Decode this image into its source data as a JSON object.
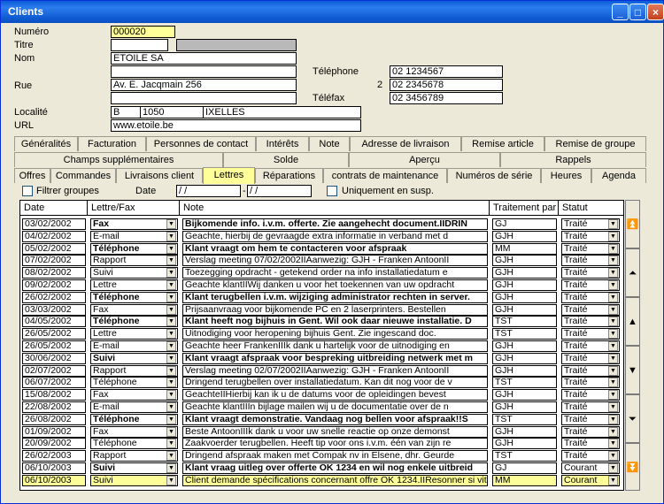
{
  "window": {
    "title": "Clients"
  },
  "form": {
    "numero_label": "Numéro",
    "numero": "000020",
    "titre_label": "Titre",
    "titre": "",
    "nom_label": "Nom",
    "nom": "ETOILE SA",
    "rue_label": "Rue",
    "rue1": "",
    "rue2": "Av. E. Jacqmain 256",
    "rue3": "",
    "telephone_label": "Téléphone",
    "telephone1": "02 1234567",
    "tel2_index": "2",
    "telephone2": "02 2345678",
    "telefax_label": "Téléfax",
    "telefax": "02 3456789",
    "localite_label": "Localité",
    "pays": "B",
    "cp": "1050",
    "ville": "IXELLES",
    "url_label": "URL",
    "url": "www.etoile.be"
  },
  "tabs_row1": [
    "Généralités",
    "Facturation",
    "Personnes de contact",
    "Intérêts",
    "Note",
    "Adresse de livraison",
    "Remise article",
    "Remise de groupe"
  ],
  "tabs_row2": [
    "Champs supplémentaires",
    "Solde",
    "Aperçu",
    "Rappels"
  ],
  "tabs_row3": [
    "Offres",
    "Commandes",
    "Livraisons client",
    "Lettres",
    "Réparations",
    "contrats de maintenance",
    "Numéros de série",
    "Heures",
    "Agenda"
  ],
  "filters": {
    "filtrer_groupes": "Filtrer groupes",
    "date_label": "Date",
    "date_from": " /  /",
    "date_sep": "-",
    "date_to": " /  /",
    "uniquement": "Uniquement en susp."
  },
  "columns": [
    "Date",
    "Lettre/Fax",
    "Note",
    "Traitement par",
    "Statut"
  ],
  "rows": [
    [
      "03/02/2002",
      "Fax",
      "Bijkomende info. i.v.m. offerte. Zie aangehecht document.IIDRIN",
      "GJ",
      "Traité",
      1
    ],
    [
      "04/02/2002",
      "E-mail",
      "Geachte, hierbij de gevraagde extra informatie in verband met d",
      "GJH",
      "Traité",
      0
    ],
    [
      "05/02/2002",
      "Téléphone",
      "Klant vraagt om hem te contacteren voor afspraak",
      "MM",
      "Traité",
      1
    ],
    [
      "07/02/2002",
      "Rapport",
      "Verslag meeting 07/02/2002IIAanwezig: GJH - Franken AntoonII",
      "GJH",
      "Traité",
      0
    ],
    [
      "08/02/2002",
      "Suivi",
      "Toezegging opdracht - getekend order na info installatiedatum e",
      "GJH",
      "Traité",
      0
    ],
    [
      "09/02/2002",
      "Lettre",
      "Geachte klantIIWij danken u voor het toekennen van uw opdracht",
      "GJH",
      "Traité",
      0
    ],
    [
      "26/02/2002",
      "Téléphone",
      "Klant terugbellen i.v.m. wijziging administrator rechten in server.",
      "GJH",
      "Traité",
      1
    ],
    [
      "03/03/2002",
      "Fax",
      "Prijsaanvraag voor bijkomende PC en 2 laserprinters. Bestellen",
      "GJH",
      "Traité",
      0
    ],
    [
      "04/05/2002",
      "Téléphone",
      "Klant heeft nog bijhuis in Gent. Wil ook daar nieuwe installatie. D",
      "TST",
      "Traité",
      1
    ],
    [
      "26/05/2002",
      "Lettre",
      "Uitnodiging voor heropening bijhuis Gent. Zie ingescand doc.",
      "TST",
      "Traité",
      0
    ],
    [
      "26/05/2002",
      "E-mail",
      "Geachte heer FrankenIIIk dank u hartelijk voor de uitnodiging en",
      "GJH",
      "Traité",
      0
    ],
    [
      "30/06/2002",
      "Suivi",
      "Klant vraagt afspraak voor bespreking uitbreiding netwerk met m",
      "GJH",
      "Traité",
      1
    ],
    [
      "02/07/2002",
      "Rapport",
      "Verslag meeting 02/07/2002IIAanwezig: GJH - Franken AntoonII",
      "GJH",
      "Traité",
      0
    ],
    [
      "06/07/2002",
      "Téléphone",
      "Dringend terugbellen over installatiedatum. Kan dit nog voor de v",
      "TST",
      "Traité",
      0
    ],
    [
      "15/08/2002",
      "Fax",
      "GeachteIIHierbij kan ik u de datums voor de opleidingen bevest",
      "GJH",
      "Traité",
      0
    ],
    [
      "22/08/2002",
      "E-mail",
      "Geachte klantIIIn bijlage mailen wij u de documentatie over de n",
      "GJH",
      "Traité",
      0
    ],
    [
      "26/08/2002",
      "Téléphone",
      "Klant vraagt demonstratie. Vandaag nog bellen voor afspraak!!S",
      "TST",
      "Traité",
      1
    ],
    [
      "01/09/2002",
      "Fax",
      "Beste AntoonIIIk dank u voor uw snelle reactie op onze demonst",
      "GJH",
      "Traité",
      0
    ],
    [
      "20/09/2002",
      "Téléphone",
      "Zaakvoerder terugbellen. Heeft tip voor ons i.v.m. één van zijn re",
      "GJH",
      "Traité",
      0
    ],
    [
      "26/02/2003",
      "Rapport",
      "Dringend afspraak maken met Compak nv in Elsene, dhr. Geurde",
      "TST",
      "Traité",
      0
    ],
    [
      "06/10/2003",
      "Suivi",
      "Klant vraag uitleg over offerte OK 1234 en wil nog enkele uitbreid",
      "GJ",
      "Courant",
      1
    ],
    [
      "06/10/2003",
      "Suivi",
      "Client demande spécifications concernant offre OK 1234.IIResonner si vite d",
      "MM",
      "Courant",
      0
    ]
  ],
  "scroll_icons": [
    "first-icon",
    "page-up-icon",
    "up-icon",
    "down-icon",
    "page-down-icon",
    "last-icon"
  ]
}
